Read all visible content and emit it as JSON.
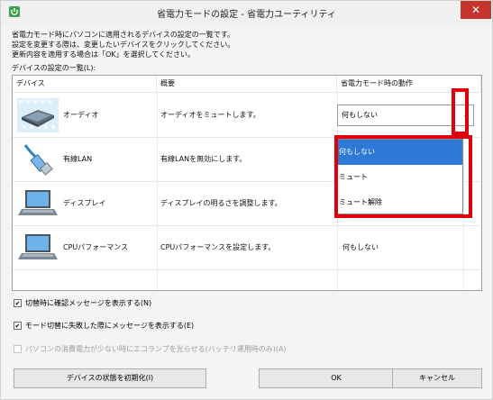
{
  "window": {
    "title": "省電力モードの設定 - 省電力ユーティリティ",
    "close_label": "✕"
  },
  "description": {
    "line1": "省電力モード時にパソコンに適用されるデバイスの設定の一覧です。",
    "line2": "設定を変更する際は、変更したいデバイスをクリックしてください。",
    "line3": "更新内容を適用する場合は「OK」を選択してください。"
  },
  "list_label": "デバイスの設定の一覧(L):",
  "table": {
    "headers": [
      "デバイス",
      "概要",
      "省電力モード時の動作"
    ],
    "rows": [
      {
        "icon": "audio-device-icon",
        "device": "オーディオ",
        "summary": "オーディオをミュートします。",
        "action": "何もしない"
      },
      {
        "icon": "ethernet-cable-icon",
        "device": "有線LAN",
        "summary": "有線LANを無効にします。",
        "action": ""
      },
      {
        "icon": "laptop-display-icon",
        "device": "ディスプレイ",
        "summary": "ディスプレイの明るさを調整します。",
        "action": ""
      },
      {
        "icon": "laptop-cpu-icon",
        "device": "CPUパフォーマンス",
        "summary": "CPUパフォーマンスを設定します。",
        "action": "何もしない"
      }
    ]
  },
  "dropdown": {
    "options": [
      "何もしない",
      "ミュート",
      "ミュート解除"
    ],
    "selected_index": 0
  },
  "checkboxes": [
    {
      "label": "切替時に確認メッセージを表示する(N)",
      "checked": true,
      "enabled": true
    },
    {
      "label": "モード切替に失敗した際にメッセージを表示する(E)",
      "checked": true,
      "enabled": true
    },
    {
      "label": "パソコンの消費電力が少ない時にエコランプを光らせる(バッテリ運用時のみ)(A)",
      "checked": false,
      "enabled": false
    }
  ],
  "buttons": {
    "reset": "デバイスの状態を初期化(I)",
    "ok": "OK",
    "cancel": "キャンセル"
  },
  "colors": {
    "highlight": "#e0000b",
    "selection": "#2c7ad6"
  }
}
